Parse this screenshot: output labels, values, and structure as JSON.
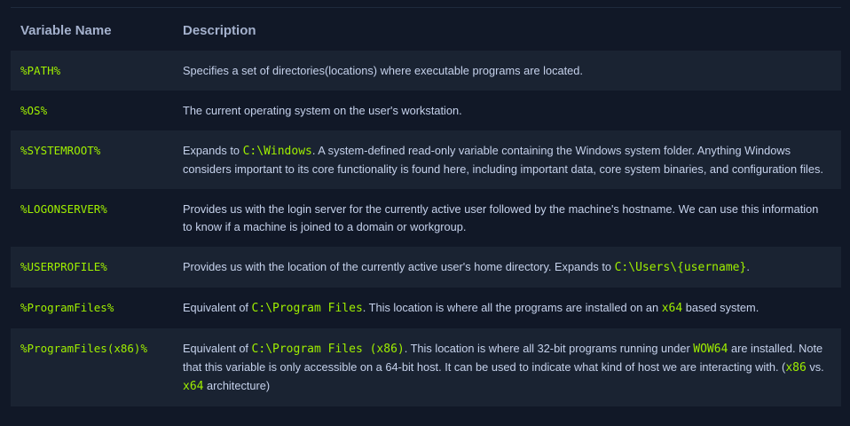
{
  "table": {
    "headers": {
      "name": "Variable Name",
      "description": "Description"
    },
    "rows": [
      {
        "name": "%PATH%",
        "desc": {
          "t1": "Specifies a set of directories(locations) where executable programs are located."
        }
      },
      {
        "name": "%OS%",
        "desc": {
          "t1": "The current operating system on the user's workstation."
        }
      },
      {
        "name": "%SYSTEMROOT%",
        "desc": {
          "t1": "Expands to ",
          "c1": "C:\\Windows",
          "t2": ". A system-defined read-only variable containing the Windows system folder. Anything Windows considers important to its core functionality is found here, including important data, core system binaries, and configuration files."
        }
      },
      {
        "name": "%LOGONSERVER%",
        "desc": {
          "t1": "Provides us with the login server for the currently active user followed by the machine's hostname. We can use this information to know if a machine is joined to a domain or workgroup."
        }
      },
      {
        "name": "%USERPROFILE%",
        "desc": {
          "t1": "Provides us with the location of the currently active user's home directory. Expands to ",
          "c1": "C:\\Users\\{username}",
          "t2": "."
        }
      },
      {
        "name": "%ProgramFiles%",
        "desc": {
          "t1": "Equivalent of ",
          "c1": "C:\\Program Files",
          "t2": ". This location is where all the programs are installed on an ",
          "c2": "x64",
          "t3": " based system."
        }
      },
      {
        "name": "%ProgramFiles(x86)%",
        "desc": {
          "t1": "Equivalent of ",
          "c1": "C:\\Program Files (x86)",
          "t2": ". This location is where all 32-bit programs running under ",
          "c2": "WOW64",
          "t3": " are installed. Note that this variable is only accessible on a 64-bit host. It can be used to indicate what kind of host we are interacting with. (",
          "c3": "x86",
          "t4": " vs. ",
          "c4": "x64",
          "t5": " architecture)"
        }
      }
    ]
  },
  "colors": {
    "background": "#111827",
    "row_alt": "#1a2332",
    "header_text": "#a4b1cd",
    "body_text": "#c5d1eb",
    "code_accent": "#9fef00"
  }
}
